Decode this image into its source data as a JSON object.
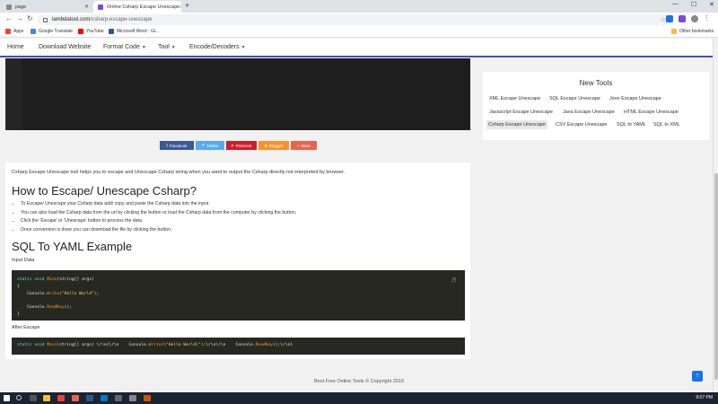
{
  "browser": {
    "tabs": [
      {
        "label": "page"
      },
      {
        "label": "Online Csharp Escape Unescape"
      }
    ],
    "url_host": "lambdatool.com",
    "url_path": "/csharp-escape-unescape",
    "bookmarks": [
      "Apps",
      "Google Translate",
      "YouTube",
      "Microsoft Word - Gi...",
      "Other bookmarks"
    ]
  },
  "nav": {
    "items": [
      "Home",
      "Download Website",
      "Format Code",
      "Tool",
      "Encode/Decoders"
    ]
  },
  "share_buttons": [
    "Facebook",
    "Twitter",
    "Pinterest",
    "Blogger",
    "More"
  ],
  "article": {
    "intro": "Csharp Escape Unescape tool helps you to escape and Unescape Csharp string when you want to output the Csharp directly not interpreted by browser.",
    "heading1": "How to Escape/ Unescape Csharp?",
    "steps": [
      "To Escape/ Unescape your Csharp data add/ copy and paste the Csharp data into the input",
      "You can also load the Csharp data from the url by clicking the  button or load the Csharp data from the computer by clicking the  button.",
      "Click the 'Escape' or 'Unescape' button to process the data.",
      "Once conversion is done you can download the file by clicking the  button."
    ],
    "heading2": "SQL To YAML Example",
    "input_label": "Input Data",
    "after_label": "After Escape",
    "input_code": {
      "l1_kw": "static void",
      "l1_fn": "Main",
      "l1_rest": "(string[] args)",
      "l2": "{",
      "l3_pre": "    Console.",
      "l3_fn": "Write",
      "l3_str": "(\"Hello World\")",
      "l3_end": ";",
      "l5_pre": "    Console.",
      "l5_fn": "ReadKey",
      "l5_end": "();",
      "l6": "}"
    },
    "output_code": {
      "kw": "static void",
      "fn": "Main",
      "a": "(string[] args) \\r\\n{\\r\\n    Console.",
      "fn2": "Write",
      "str": "(\\\"Hello World\\\")",
      "b": ";\\r\\n\\r\\n    Console.",
      "fn3": "ReadKey",
      "c": "();\\r\\n}"
    }
  },
  "sidebar": {
    "title": "New Tools",
    "tools": [
      "XML Escape Unescape",
      "SQL Escape Unescape",
      "Json Escape Unescape",
      "Javascript Escape Unescape",
      "Java Escape Unescape",
      "HTML Escape Unescape",
      "Csharp Escape Unescape",
      "CSV Escape Unescape",
      "SQL to YAML",
      "SQL to XML"
    ]
  },
  "footer": "Best Free Online Tools © Copyright 2019",
  "taskbar": {
    "time": "9:07 PM"
  },
  "colors": {
    "nav_accent": "#3f51b5",
    "facebook": "#3b5998",
    "twitter": "#55acee",
    "pinterest": "#cb2027",
    "blogger": "#f4942f",
    "more": "#e8654d"
  }
}
